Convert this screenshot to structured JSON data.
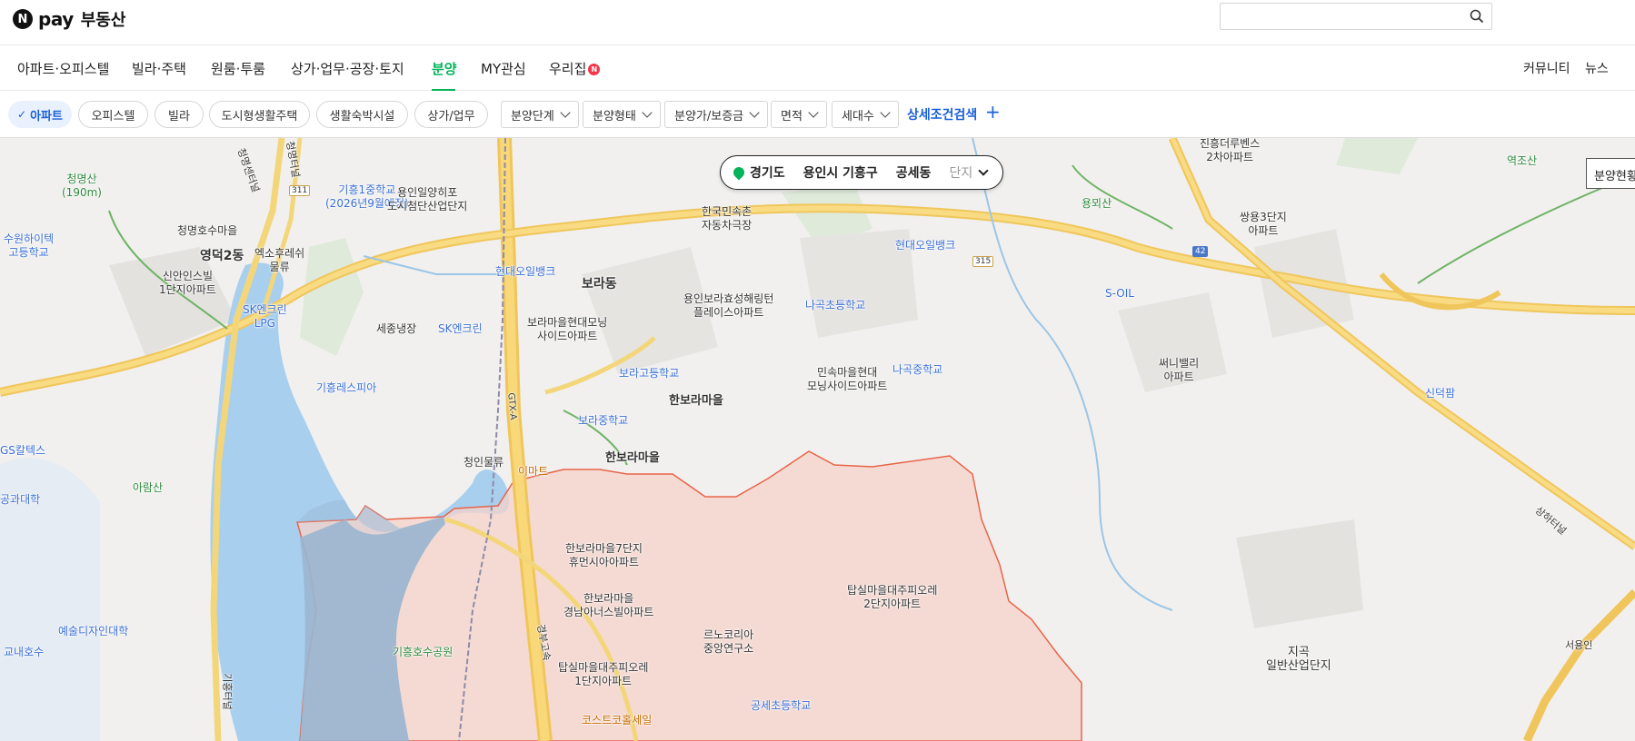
{
  "brand": {
    "n": "N",
    "pay": "pay",
    "name": "부동산"
  },
  "search": {
    "placeholder": ""
  },
  "nav": {
    "items": [
      {
        "label": "아파트·오피스텔"
      },
      {
        "label": "빌라·주택"
      },
      {
        "label": "원룸·투룸"
      },
      {
        "label": "상가·업무·공장·토지"
      },
      {
        "label": "분양"
      },
      {
        "label": "MY관심"
      },
      {
        "label": "우리집"
      }
    ],
    "badge": "N",
    "right": {
      "community": "커뮤니티",
      "news": "뉴스"
    }
  },
  "filters": {
    "chips": [
      "아파트",
      "오피스텔",
      "빌라",
      "도시형생활주택",
      "생활숙박시설",
      "상가/업무"
    ],
    "dropdowns": [
      "분양단계",
      "분양형태",
      "분양가/보증금",
      "면적",
      "세대수"
    ],
    "advanced": "상세조건검색",
    "plus": "+"
  },
  "location": {
    "province": "경기도",
    "city": "용인시 기흥구",
    "dong": "공세동",
    "complex": "단지"
  },
  "status_button": "분양현황",
  "map_labels": {
    "a1": "청명산\n(190m)",
    "a2": "수원하이텍\n고등학교",
    "a3": "청명호수마을",
    "a4": "영덕2동",
    "a5": "신안인스빌\n1단지아파트",
    "a6": "엑소후레쉬\n물류",
    "a7": "SK엔크린\nLPG",
    "a8": "기흥1중학교\n(2026년9월예정)",
    "a9": "용인일양히포\n도시첨단산업단지",
    "a10": "현대오일뱅크",
    "a11": "세종냉장",
    "a12": "SK엔크린",
    "a13": "기흥레스피아",
    "a14": "GS칼텍스",
    "a15": "아람산",
    "a16": "공과대학",
    "a17": "예술디자인대학",
    "a18": "교내호수",
    "a19": "보라동",
    "a20": "한국민속촌\n자동차극장",
    "a21": "용인보라효성해링턴\n플레이스아파트",
    "a22": "보라마을현대모닝\n사이드아파트",
    "a23": "보라고등학교",
    "a24": "보라중학교",
    "a25": "한보라마을",
    "a26": "한보라마을",
    "a27": "청인물류",
    "a28": "이마트",
    "a29": "한보라마을7단지\n휴먼시아아파트",
    "a30": "한보라마을\n경남아너스빌아파트",
    "a31": "기흥호수공원",
    "a32": "탑실마을대주피오레\n1단지아파트",
    "a33": "르노코리아\n중앙연구소",
    "a34": "코스트코홀세일",
    "a35": "공세초등학교",
    "a36": "탑실마을대주피오레\n2단지아파트",
    "a37": "나곡초등학교",
    "a38": "민속마을현대\n모닝사이드아파트",
    "a39": "나곡중학교",
    "a40": "현대오일뱅크",
    "a41": "진흥더루벤스\n2차아파트",
    "a42": "쌍용3단지\n아파트",
    "a43": "용뫼산",
    "a44": "S-OIL",
    "a45": "써니밸리\n아파트",
    "a46": "신덕팜",
    "a47": "역조산",
    "a48": "지곡\n일반산업단지",
    "a49": "서용인",
    "a50": "경부고속",
    "a51": "GTX-A",
    "a52": "기흥터널",
    "a53": "청명센터널",
    "a54": "청명터널",
    "a55": "상하터널",
    "r311": "311",
    "r315": "315",
    "r42": "42"
  }
}
